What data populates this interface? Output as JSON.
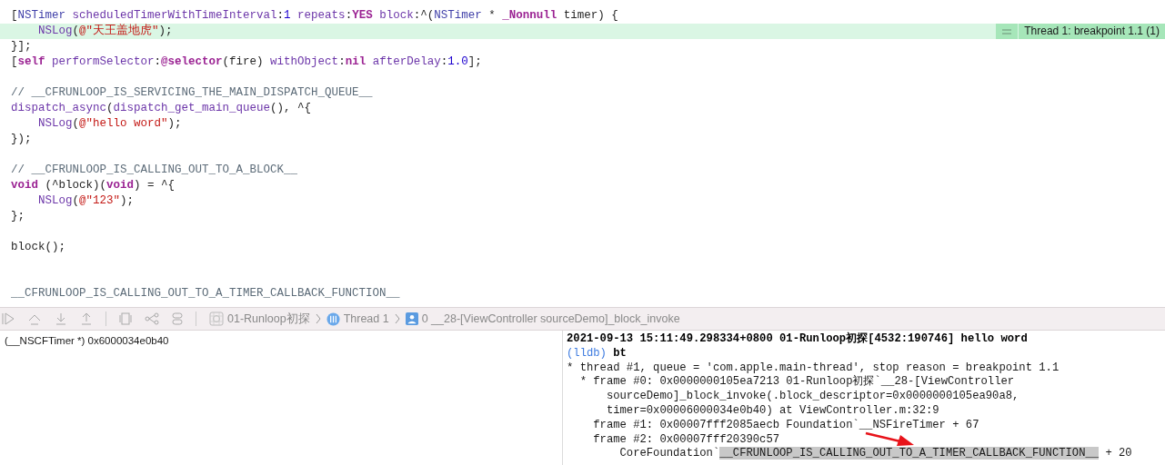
{
  "editor": {
    "lines": [
      {
        "highlighted": false,
        "tokens": [
          {
            "kind": "plain",
            "text": "["
          },
          {
            "kind": "type",
            "text": "NSTimer"
          },
          {
            "kind": "method",
            "text": " scheduledTimerWithTimeInterval"
          },
          {
            "kind": "plain",
            "text": ":"
          },
          {
            "kind": "number",
            "text": "1"
          },
          {
            "kind": "method",
            "text": " repeats"
          },
          {
            "kind": "plain",
            "text": ":"
          },
          {
            "kind": "keyword",
            "text": "YES"
          },
          {
            "kind": "method",
            "text": " block"
          },
          {
            "kind": "plain",
            "text": ":^("
          },
          {
            "kind": "type",
            "text": "NSTimer"
          },
          {
            "kind": "plain",
            "text": " * "
          },
          {
            "kind": "keyword",
            "text": "_Nonnull"
          },
          {
            "kind": "plain",
            "text": " timer) {"
          }
        ]
      },
      {
        "highlighted": true,
        "tokens": [
          {
            "kind": "method",
            "text": "    NSLog"
          },
          {
            "kind": "plain",
            "text": "("
          },
          {
            "kind": "string",
            "text": "@\"天王盖地虎\""
          },
          {
            "kind": "plain",
            "text": ");"
          }
        ]
      },
      {
        "highlighted": false,
        "tokens": [
          {
            "kind": "plain",
            "text": "}];"
          }
        ]
      },
      {
        "highlighted": false,
        "tokens": [
          {
            "kind": "plain",
            "text": "["
          },
          {
            "kind": "keyword",
            "text": "self"
          },
          {
            "kind": "method",
            "text": " performSelector"
          },
          {
            "kind": "plain",
            "text": ":"
          },
          {
            "kind": "keyword",
            "text": "@selector"
          },
          {
            "kind": "plain",
            "text": "(fire) "
          },
          {
            "kind": "method",
            "text": "withObject"
          },
          {
            "kind": "plain",
            "text": ":"
          },
          {
            "kind": "keyword",
            "text": "nil"
          },
          {
            "kind": "method",
            "text": " afterDelay"
          },
          {
            "kind": "plain",
            "text": ":"
          },
          {
            "kind": "number",
            "text": "1.0"
          },
          {
            "kind": "plain",
            "text": "];"
          }
        ]
      },
      {
        "highlighted": false
      },
      {
        "highlighted": false,
        "tokens": [
          {
            "kind": "comment",
            "text": "// __CFRUNLOOP_IS_SERVICING_THE_MAIN_DISPATCH_QUEUE__"
          }
        ]
      },
      {
        "highlighted": false,
        "tokens": [
          {
            "kind": "method",
            "text": "dispatch_async"
          },
          {
            "kind": "plain",
            "text": "("
          },
          {
            "kind": "method",
            "text": "dispatch_get_main_queue"
          },
          {
            "kind": "plain",
            "text": "(), ^{"
          }
        ]
      },
      {
        "highlighted": false,
        "tokens": [
          {
            "kind": "method",
            "text": "    NSLog"
          },
          {
            "kind": "plain",
            "text": "("
          },
          {
            "kind": "string",
            "text": "@\"hello word\""
          },
          {
            "kind": "plain",
            "text": ");"
          }
        ]
      },
      {
        "highlighted": false,
        "tokens": [
          {
            "kind": "plain",
            "text": "});"
          }
        ]
      },
      {
        "highlighted": false
      },
      {
        "highlighted": false,
        "tokens": [
          {
            "kind": "comment",
            "text": "// __CFRUNLOOP_IS_CALLING_OUT_TO_A_BLOCK__"
          }
        ]
      },
      {
        "highlighted": false,
        "tokens": [
          {
            "kind": "keyword",
            "text": "void"
          },
          {
            "kind": "plain",
            "text": " (^block)("
          },
          {
            "kind": "keyword",
            "text": "void"
          },
          {
            "kind": "plain",
            "text": ") = ^{"
          }
        ]
      },
      {
        "highlighted": false,
        "tokens": [
          {
            "kind": "method",
            "text": "    NSLog"
          },
          {
            "kind": "plain",
            "text": "("
          },
          {
            "kind": "string",
            "text": "@\"123\""
          },
          {
            "kind": "plain",
            "text": ");"
          }
        ]
      },
      {
        "highlighted": false,
        "tokens": [
          {
            "kind": "plain",
            "text": "};"
          }
        ]
      },
      {
        "highlighted": false
      },
      {
        "highlighted": false,
        "tokens": [
          {
            "kind": "plain",
            "text": "block();"
          }
        ]
      },
      {
        "highlighted": false
      },
      {
        "highlighted": false
      },
      {
        "highlighted": false,
        "tokens": [
          {
            "kind": "comment",
            "text": "__CFRUNLOOP_IS_CALLING_OUT_TO_A_TIMER_CALLBACK_FUNCTION__"
          }
        ]
      }
    ],
    "breakpoint_badge": {
      "label": "Thread 1: breakpoint 1.1 (1)"
    }
  },
  "debug_bar": {
    "breadcrumbs": [
      {
        "kind": "app",
        "label": "01-Runloop初探"
      },
      {
        "kind": "thread",
        "label": "Thread 1"
      },
      {
        "kind": "frame",
        "label": "0 __28-[ViewController sourceDemo]_block_invoke"
      }
    ]
  },
  "variables": [
    {
      "text": "(__NSCFTimer *) 0x6000034e0b40"
    }
  ],
  "console": {
    "lines": [
      [
        {
          "kind": "bold",
          "text": "2021-09-13 15:11:49.298334+0800 01-Runloop初探[4532:190746] hello word"
        }
      ],
      [
        {
          "kind": "prompt",
          "text": "(lldb)"
        },
        {
          "kind": "bold",
          "text": " bt"
        }
      ],
      [
        {
          "kind": "plain",
          "text": "* thread #1, queue = 'com.apple.main-thread', stop reason = breakpoint 1.1"
        }
      ],
      [
        {
          "kind": "plain",
          "text": "  * frame #0: 0x0000000105ea7213 01-Runloop初探`__28-[ViewController"
        }
      ],
      [
        {
          "kind": "plain",
          "text": "      sourceDemo]_block_invoke(.block_descriptor=0x0000000105ea90a8,"
        }
      ],
      [
        {
          "kind": "plain",
          "text": "      timer=0x00006000034e0b40) at ViewController.m:32:9"
        }
      ],
      [
        {
          "kind": "plain",
          "text": "    frame #1: 0x00007fff2085aecb Foundation`__NSFireTimer + 67"
        }
      ],
      [
        {
          "kind": "plain",
          "text": "    frame #2: 0x00007fff20390c57"
        }
      ],
      [
        {
          "kind": "plain",
          "text": "        CoreFoundation`"
        },
        {
          "kind": "highlight",
          "text": "__CFRUNLOOP_IS_CALLING_OUT_TO_A_TIMER_CALLBACK_FUNCTION__"
        },
        {
          "kind": "plain",
          "text": " + 20"
        }
      ]
    ]
  }
}
